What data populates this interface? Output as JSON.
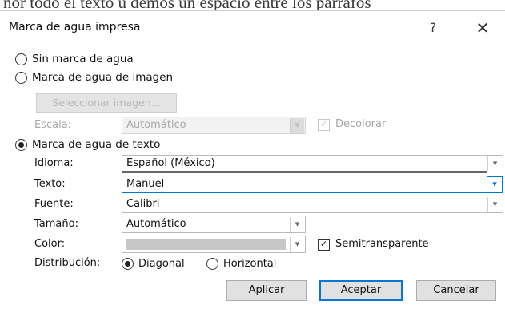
{
  "background_text": "nor todo el texto u demos un espacio entre los párrafos",
  "dialog": {
    "title": "Marca de agua impresa",
    "help_glyph": "?",
    "close_glyph": "✕"
  },
  "options": {
    "no_watermark": "Sin marca de agua",
    "picture_watermark": "Marca de agua de imagen",
    "select_picture_button": "Seleccionar imagen...",
    "scale_label": "Escala:",
    "scale_value": "Automático",
    "washout_label": "Decolorar",
    "text_watermark": "Marca de agua de texto"
  },
  "text_options": {
    "language_label": "Idioma:",
    "language_value": "Español (México)",
    "text_label": "Texto:",
    "text_value": "Manuel",
    "font_label": "Fuente:",
    "font_value": "Calibri",
    "size_label": "Tamaño:",
    "size_value": "Automático",
    "color_label": "Color:",
    "semitransparent_label": "Semitransparente",
    "layout_label": "Distribución:",
    "diagonal_label": "Diagonal",
    "horizontal_label": "Horizontal"
  },
  "selected_option": "text_watermark",
  "selected_layout": "diagonal",
  "semitransparent_checked": true,
  "washout_checked": true,
  "buttons": {
    "apply": "Aplicar",
    "ok": "Aceptar",
    "cancel": "Cancelar"
  },
  "icons": {
    "dropdown": "chevron-down-icon",
    "radio": "radio-icon",
    "checkbox": "checkbox-icon"
  },
  "colors": {
    "accent": "#0078d7",
    "watermark_color": "#c7c7c7",
    "button_face": "#e1e1e1"
  }
}
